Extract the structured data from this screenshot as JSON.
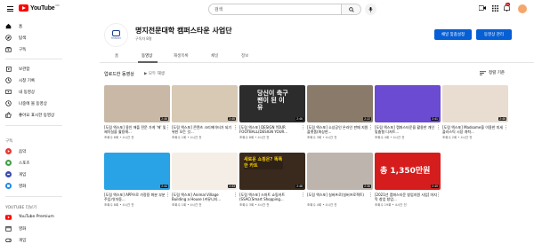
{
  "header": {
    "logo_word": "YouTube",
    "logo_country": "KR",
    "search_placeholder": "검색",
    "notification_count": "9+"
  },
  "sidebar": {
    "main": [
      {
        "label": "홈",
        "icon": "home-icon"
      },
      {
        "label": "탐색",
        "icon": "explore-icon"
      },
      {
        "label": "구독",
        "icon": "subscriptions-icon"
      }
    ],
    "library": [
      {
        "label": "보관함",
        "icon": "library-icon"
      },
      {
        "label": "시청 기록",
        "icon": "history-icon"
      },
      {
        "label": "내 동영상",
        "icon": "my-videos-icon"
      },
      {
        "label": "나중에 볼 동영상",
        "icon": "watch-later-icon"
      },
      {
        "label": "좋아요 표시한 동영상",
        "icon": "like-icon"
      }
    ],
    "subscriptions_title": "구독",
    "subscriptions": [
      {
        "label": "음악",
        "color": "#e53935"
      },
      {
        "label": "스포츠",
        "color": "#43a047"
      },
      {
        "label": "게임",
        "color": "#3949ab"
      },
      {
        "label": "영화",
        "color": "#1e88e5"
      }
    ],
    "more_title": "YOUTUBE 더보기",
    "more": [
      {
        "label": "YouTube Premium",
        "icon": "youtube-premium-icon"
      },
      {
        "label": "영화",
        "icon": "movies-icon"
      },
      {
        "label": "게임",
        "icon": "gaming-icon"
      }
    ]
  },
  "channel": {
    "name": "명지전문대학 캠퍼스타운 사업단",
    "subscribers": "구독자 8명",
    "avatar_caption": "명지전문대학",
    "customize_label": "채널 맞춤설정",
    "manage_label": "동영상 관리"
  },
  "tabs": [
    "홈",
    "동영상",
    "재생목록",
    "채널",
    "정보"
  ],
  "active_tab": 1,
  "section": {
    "title": "업로드한 동영상",
    "play_all": "모두 재생",
    "sort_label": "정렬 기준"
  },
  "videos": [
    {
      "title": "[도림 엑스포] 용인 애플 전문 가게 '애' 및 제작실을 활용해...",
      "meta": "조회수 8회 • 4시간 전",
      "duration": "2:46",
      "bg": "#c9b8a6",
      "overlay": ""
    },
    {
      "title": "[도림 엑스포] 콘텐츠 크리에이터가 되기 위한 모든 것...",
      "meta": "조회수 1회 • 4시간 전",
      "duration": "2:45",
      "bg": "#d8c9b5",
      "overlay": ""
    },
    {
      "title": "[도림 엑스포] DESIGN YOUR FOOTBALL(DESIGN YOUR...",
      "meta": "조회수 8회 • 4시간 전",
      "duration": "2:46",
      "bg": "#2c2c2c",
      "overlay": "당신이 축구팬이 된 이유"
    },
    {
      "title": "[도림 엑스포] 소상공인 온라인 판매 지원 플랫폼(화상판...",
      "meta": "조회수 3회 • 4시간 전",
      "duration": "2:22",
      "bg": "#8a7a6a",
      "overlay": ""
    },
    {
      "title": "[도림 엑스포] 캠퍼스타운을 활용한 개인 맞춤형 디저트...",
      "meta": "조회수 4회 • 4시간 전",
      "duration": "2:41",
      "bg": "#6a4bd1",
      "overlay": ""
    },
    {
      "title": "[도림 엑스포] Madsome을 이용한 미세 플라스틱 시장 개척...",
      "meta": "조회수 2회 • 4시간 전",
      "duration": "2:46",
      "bg": "#e8ddd0",
      "overlay": ""
    },
    {
      "title": "[도림 엑스포] APP으로 가정용 화분 부분 주입기(자동...",
      "meta": "조회수 8회 • 4시간 전",
      "duration": "2:44",
      "bg": "#29a3e6",
      "overlay": ""
    },
    {
      "title": "[도림 엑스포] Animal Village Building a House (커뮤니티...",
      "meta": "조회수 1회 • 4시간 전",
      "duration": "2:33",
      "bg": "#f4eee6",
      "overlay": ""
    },
    {
      "title": "[도림 엑스포] 스마트 쇼핑카트(SSAC(Smart Shopping...",
      "meta": "조회수 3회 • 4시간 전",
      "duration": "2:48",
      "bg": "#3a2a1e",
      "overlay": "새로운 쇼핑은? 똑똑한 카트"
    },
    {
      "title": "[도림 엑스포] 실버프로(실버프로젝트)",
      "meta": "조회수 4회 • 4시간 전",
      "duration": "2:36",
      "bg": "#bdb5ad",
      "overlay": ""
    },
    {
      "title": "[2021년 캠퍼스타운 창업지원 사업] 마지막 창업 창업...",
      "meta": "조회수 19회 • 4시간 전",
      "duration": "2:49",
      "bg": "#d61d1d",
      "overlay": "총 1,350만원"
    }
  ],
  "colors": {
    "accent": "#065fd4",
    "brand_red": "#ff0000"
  }
}
